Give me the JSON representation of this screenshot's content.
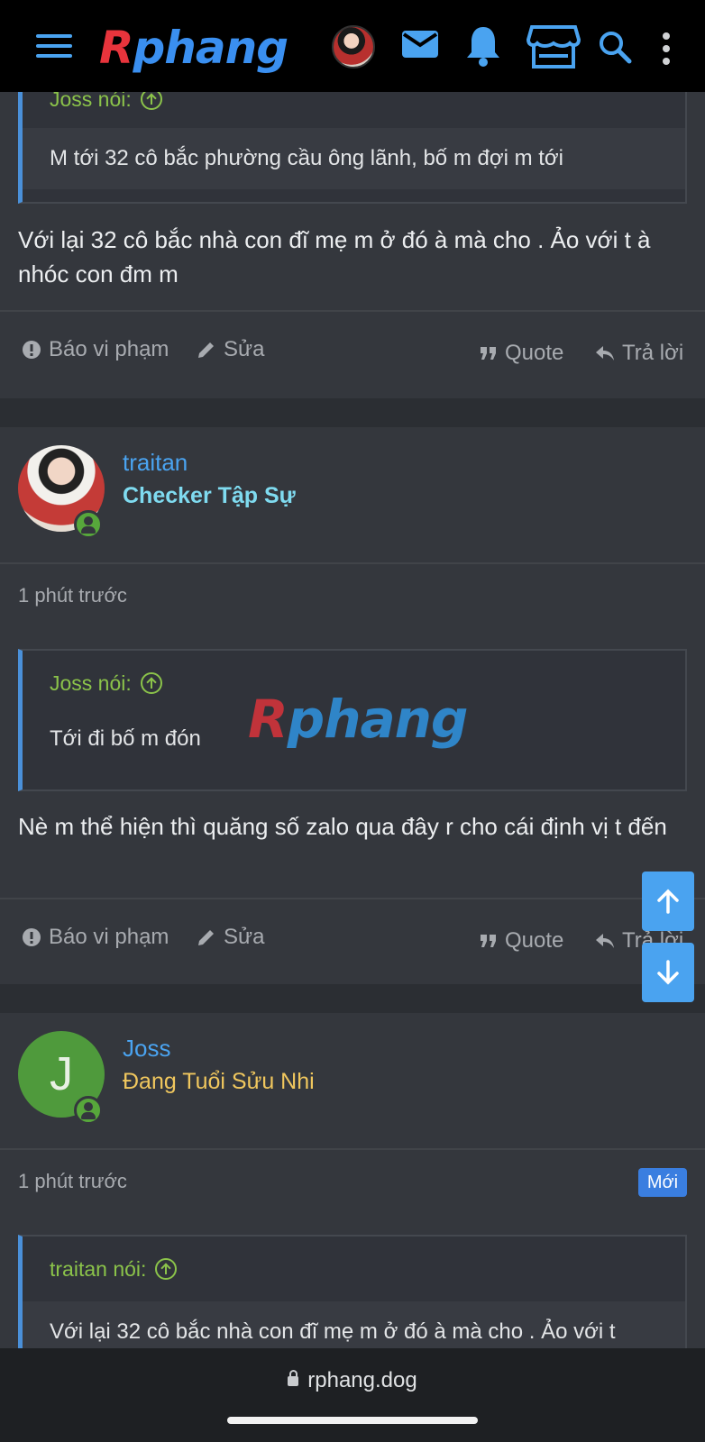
{
  "header": {
    "logo_r": "R",
    "logo_rest": "phang",
    "icons": [
      "menu-icon",
      "avatar",
      "mail-icon",
      "bell-icon",
      "store-icon",
      "search-icon",
      "more-vertical-icon"
    ]
  },
  "post1": {
    "quote_author": "Joss nói:",
    "quote_text": "M tới 32 cô bắc phường cầu ông lãnh, bố m đợi m tới",
    "message": "Với lại 32 cô bắc nhà con đĩ mẹ m ở đó à mà cho . Ảo với t à nhóc con đm m",
    "actions": {
      "report": "Báo vi phạm",
      "edit": "Sửa",
      "quote": "Quote",
      "reply": "Trả lời"
    }
  },
  "post2": {
    "username": "traitan",
    "user_title": "Checker Tập Sự",
    "user_title_color": "#7fdbf0",
    "time": "1 phút trước",
    "quote_author": "Joss nói:",
    "quote_text": "Tới đi bố m đón",
    "message": "Nè m thể hiện thì quăng số zalo qua đây r cho cái định vị t đến",
    "actions": {
      "report": "Báo vi phạm",
      "edit": "Sửa",
      "quote": "Quote",
      "reply": "Trả lời"
    }
  },
  "post3": {
    "username": "Joss",
    "avatar_letter": "J",
    "user_title": "Đang Tuổi Sửu Nhi",
    "user_title_color": "#f0c75e",
    "time": "1 phút trước",
    "badge": "Mới",
    "quote_author": "traitan nói:",
    "quote_text": "Với lại 32 cô bắc nhà con đĩ mẹ m ở đó à mà cho . Ảo với t"
  },
  "watermark": {
    "r": "R",
    "rest": "phang"
  },
  "browser": {
    "url": "rphang.dog"
  },
  "colors": {
    "accent": "#4aa3f0",
    "quote_green": "#8bc34a",
    "badge_blue": "#3a7ee0"
  }
}
